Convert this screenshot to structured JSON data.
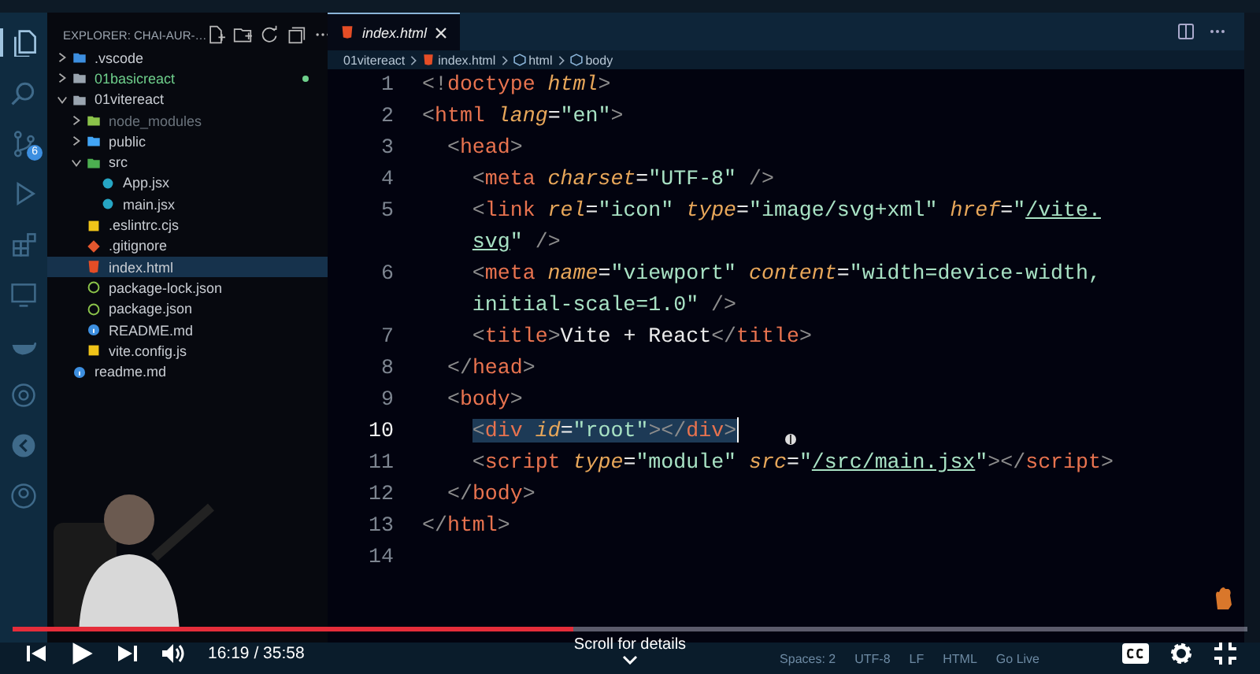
{
  "editor_window": {
    "activity_bar": [
      {
        "kind": "files",
        "selected": true
      },
      {
        "kind": "search",
        "selected": false
      },
      {
        "kind": "source-control",
        "selected": false,
        "badge": "6"
      },
      {
        "kind": "run",
        "selected": false
      },
      {
        "kind": "extensions",
        "selected": false
      },
      {
        "kind": "remote",
        "selected": false
      },
      {
        "kind": "docker",
        "selected": false
      },
      {
        "kind": "at",
        "selected": false
      },
      {
        "kind": "liveshare",
        "selected": false
      },
      {
        "kind": "account",
        "selected": false
      }
    ],
    "explorer": {
      "title": "EXPLORER: CHAI-AUR-…",
      "tree": [
        {
          "label": ".vscode",
          "kind": "folder-vscode",
          "expanded": false,
          "selected": false,
          "untracked": false
        },
        {
          "label": "01basicreact",
          "kind": "folder",
          "expanded": false,
          "selected": false,
          "untracked": true
        },
        {
          "label": "01vitereact",
          "kind": "folder",
          "expanded": true,
          "selected": false,
          "untracked": false,
          "children": [
            {
              "label": "node_modules",
              "kind": "folder-node",
              "expanded": false,
              "selected": false,
              "ignored": true
            },
            {
              "label": "public",
              "kind": "folder-blue",
              "expanded": false,
              "selected": false,
              "ignored": false
            },
            {
              "label": "src",
              "kind": "folder-src",
              "expanded": true,
              "selected": false,
              "ignored": false,
              "children": [
                {
                  "label": "App.jsx",
                  "kind": "react",
                  "selected": false
                },
                {
                  "label": "main.jsx",
                  "kind": "react",
                  "selected": false
                }
              ]
            },
            {
              "label": ".eslintrc.cjs",
              "kind": "yellow",
              "selected": false,
              "ignored": false
            },
            {
              "label": ".gitignore",
              "kind": "git",
              "selected": false,
              "ignored": false
            },
            {
              "label": "index.html",
              "kind": "html",
              "selected": true,
              "ignored": false
            },
            {
              "label": "package-lock.json",
              "kind": "npm",
              "selected": false,
              "ignored": false
            },
            {
              "label": "package.json",
              "kind": "npm",
              "selected": false,
              "ignored": false
            },
            {
              "label": "README.md",
              "kind": "info",
              "selected": false,
              "ignored": false
            },
            {
              "label": "vite.config.js",
              "kind": "yellow",
              "selected": false,
              "ignored": false
            }
          ]
        },
        {
          "label": "readme.md",
          "kind": "info",
          "selected": false,
          "untracked": false
        }
      ]
    },
    "tabs": [
      {
        "label": "index.html",
        "kind": "html",
        "selected": true
      }
    ],
    "breadcrumbs": [
      {
        "label": "01vitereact",
        "kind": "folder"
      },
      {
        "label": "index.html",
        "kind": "html"
      },
      {
        "label": "html",
        "kind": "element"
      },
      {
        "label": "body",
        "kind": "element"
      }
    ],
    "code": [
      {
        "number": "1",
        "selected": false,
        "tokens": [
          {
            "t": "<!",
            "kind": "punct"
          },
          {
            "t": "doctype",
            "kind": "tag"
          },
          {
            "t": " html",
            "kind": "attr"
          },
          {
            "t": ">",
            "kind": "punct"
          }
        ]
      },
      {
        "number": "2",
        "selected": false,
        "tokens": [
          {
            "t": "<",
            "kind": "punct"
          },
          {
            "t": "html",
            "kind": "tag"
          },
          {
            "t": " lang",
            "kind": "attr"
          },
          {
            "t": "=",
            "kind": "eq"
          },
          {
            "t": "\"en\"",
            "kind": "string"
          },
          {
            "t": ">",
            "kind": "punct"
          }
        ]
      },
      {
        "number": "3",
        "selected": false,
        "tokens": [
          {
            "t": "  <",
            "kind": "punct"
          },
          {
            "t": "head",
            "kind": "tag"
          },
          {
            "t": ">",
            "kind": "punct"
          }
        ]
      },
      {
        "number": "4",
        "selected": false,
        "tokens": [
          {
            "t": "    <",
            "kind": "punct"
          },
          {
            "t": "meta",
            "kind": "tag"
          },
          {
            "t": " charset",
            "kind": "attr"
          },
          {
            "t": "=",
            "kind": "eq"
          },
          {
            "t": "\"UTF-8\"",
            "kind": "string"
          },
          {
            "t": " />",
            "kind": "punct"
          }
        ]
      },
      {
        "number": "5",
        "selected": false,
        "tokens": [
          {
            "t": "    <",
            "kind": "punct"
          },
          {
            "t": "link",
            "kind": "tag"
          },
          {
            "t": " rel",
            "kind": "attr"
          },
          {
            "t": "=",
            "kind": "eq"
          },
          {
            "t": "\"icon\"",
            "kind": "string"
          },
          {
            "t": " type",
            "kind": "attr"
          },
          {
            "t": "=",
            "kind": "eq"
          },
          {
            "t": "\"image/svg+xml\"",
            "kind": "string"
          },
          {
            "t": " href",
            "kind": "attr"
          },
          {
            "t": "=",
            "kind": "eq"
          },
          {
            "t": "\"",
            "kind": "string"
          },
          {
            "t": "/vite.",
            "kind": "link"
          },
          {
            "kind": "wrap"
          },
          {
            "t": "    svg",
            "kind": "link"
          },
          {
            "t": "\"",
            "kind": "string"
          },
          {
            "t": " />",
            "kind": "punct"
          }
        ]
      },
      {
        "number": "6",
        "selected": false,
        "tokens": [
          {
            "t": "    <",
            "kind": "punct"
          },
          {
            "t": "meta",
            "kind": "tag"
          },
          {
            "t": " name",
            "kind": "attr"
          },
          {
            "t": "=",
            "kind": "eq"
          },
          {
            "t": "\"viewport\"",
            "kind": "string"
          },
          {
            "t": " content",
            "kind": "attr"
          },
          {
            "t": "=",
            "kind": "eq"
          },
          {
            "t": "\"width=device-width,",
            "kind": "string"
          },
          {
            "kind": "wrap"
          },
          {
            "t": "    initial-scale=1.0\"",
            "kind": "string"
          },
          {
            "t": " />",
            "kind": "punct"
          }
        ]
      },
      {
        "number": "7",
        "selected": false,
        "tokens": [
          {
            "t": "    <",
            "kind": "punct"
          },
          {
            "t": "title",
            "kind": "tag"
          },
          {
            "t": ">",
            "kind": "punct"
          },
          {
            "t": "Vite + React",
            "kind": "text"
          },
          {
            "t": "</",
            "kind": "punct"
          },
          {
            "t": "title",
            "kind": "tag"
          },
          {
            "t": ">",
            "kind": "punct"
          }
        ]
      },
      {
        "number": "8",
        "selected": false,
        "tokens": [
          {
            "t": "  </",
            "kind": "punct"
          },
          {
            "t": "head",
            "kind": "tag"
          },
          {
            "t": ">",
            "kind": "punct"
          }
        ]
      },
      {
        "number": "9",
        "selected": false,
        "tokens": [
          {
            "t": "  <",
            "kind": "punct"
          },
          {
            "t": "body",
            "kind": "tag"
          },
          {
            "t": ">",
            "kind": "punct"
          }
        ]
      },
      {
        "number": "10",
        "selected": true,
        "tokens": [
          {
            "t": "    <",
            "kind": "punct"
          },
          {
            "t": "div",
            "kind": "tag"
          },
          {
            "t": " id",
            "kind": "attr"
          },
          {
            "t": "=",
            "kind": "eq"
          },
          {
            "t": "\"root\"",
            "kind": "string"
          },
          {
            "t": "></",
            "kind": "punct"
          },
          {
            "t": "div",
            "kind": "tag"
          },
          {
            "t": ">",
            "kind": "punct"
          }
        ]
      },
      {
        "number": "11",
        "selected": false,
        "tokens": [
          {
            "t": "    <",
            "kind": "punct"
          },
          {
            "t": "script",
            "kind": "tag"
          },
          {
            "t": " type",
            "kind": "attr"
          },
          {
            "t": "=",
            "kind": "eq"
          },
          {
            "t": "\"module\"",
            "kind": "string"
          },
          {
            "t": " src",
            "kind": "attr"
          },
          {
            "t": "=",
            "kind": "eq"
          },
          {
            "t": "\"",
            "kind": "string"
          },
          {
            "t": "/src/main.jsx",
            "kind": "link"
          },
          {
            "t": "\"",
            "kind": "string"
          },
          {
            "t": "></",
            "kind": "punct"
          },
          {
            "t": "script",
            "kind": "tag"
          },
          {
            "t": ">",
            "kind": "punct"
          }
        ]
      },
      {
        "number": "12",
        "selected": false,
        "tokens": [
          {
            "t": "  </",
            "kind": "punct"
          },
          {
            "t": "body",
            "kind": "tag"
          },
          {
            "t": ">",
            "kind": "punct"
          }
        ]
      },
      {
        "number": "13",
        "selected": false,
        "tokens": [
          {
            "t": "</",
            "kind": "punct"
          },
          {
            "t": "html",
            "kind": "tag"
          },
          {
            "t": ">",
            "kind": "punct"
          }
        ]
      },
      {
        "number": "14",
        "selected": false
      }
    ],
    "status_bar": [
      "Spaces: 2",
      "UTF-8",
      "LF",
      "HTML",
      "Go Live"
    ]
  },
  "video_player": {
    "progress": {
      "level": 0.454
    },
    "time": "16:19 / 35:58",
    "hint": "Scroll for details"
  }
}
